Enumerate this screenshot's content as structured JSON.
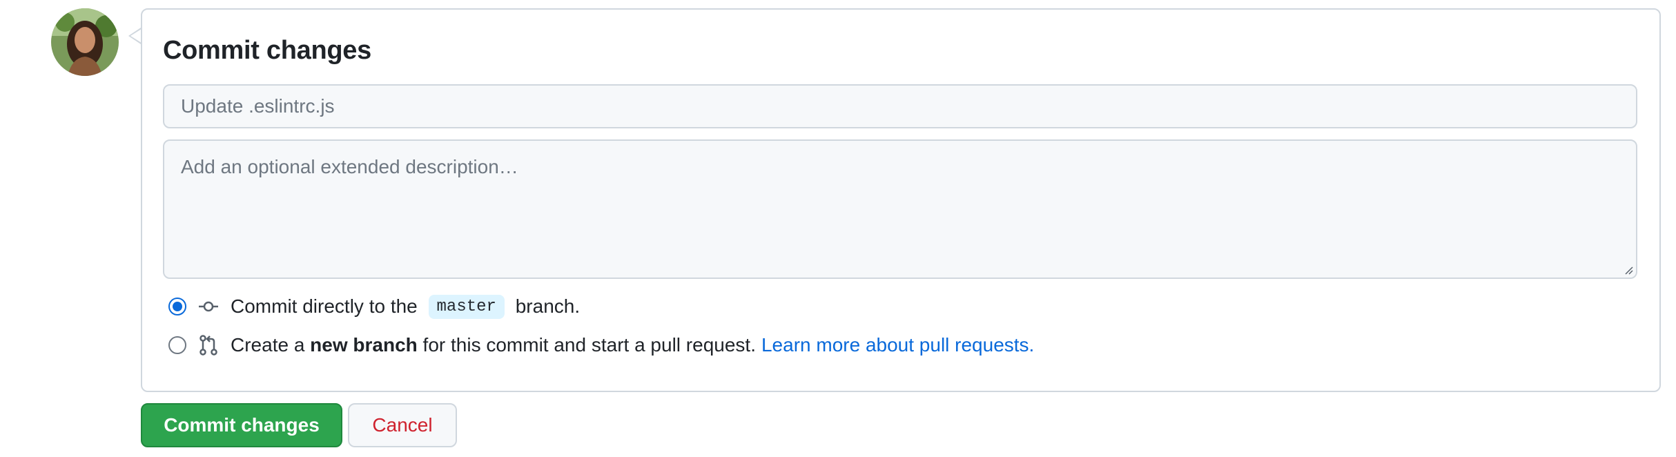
{
  "avatar": {
    "alt": "User avatar"
  },
  "form": {
    "title": "Commit changes",
    "summary_placeholder": "Update .eslintrc.js",
    "description_placeholder": "Add an optional extended description…"
  },
  "options": {
    "direct": {
      "text_before": "Commit directly to the ",
      "branch": "master",
      "text_after": " branch.",
      "selected": true
    },
    "new_branch": {
      "text_before": "Create a ",
      "bold": "new branch",
      "text_after": " for this commit and start a pull request.",
      "link": "Learn more about pull requests.",
      "selected": false
    }
  },
  "buttons": {
    "commit": "Commit changes",
    "cancel": "Cancel"
  },
  "colors": {
    "primary": "#2da44e",
    "link": "#0969da",
    "danger": "#cf222e"
  }
}
